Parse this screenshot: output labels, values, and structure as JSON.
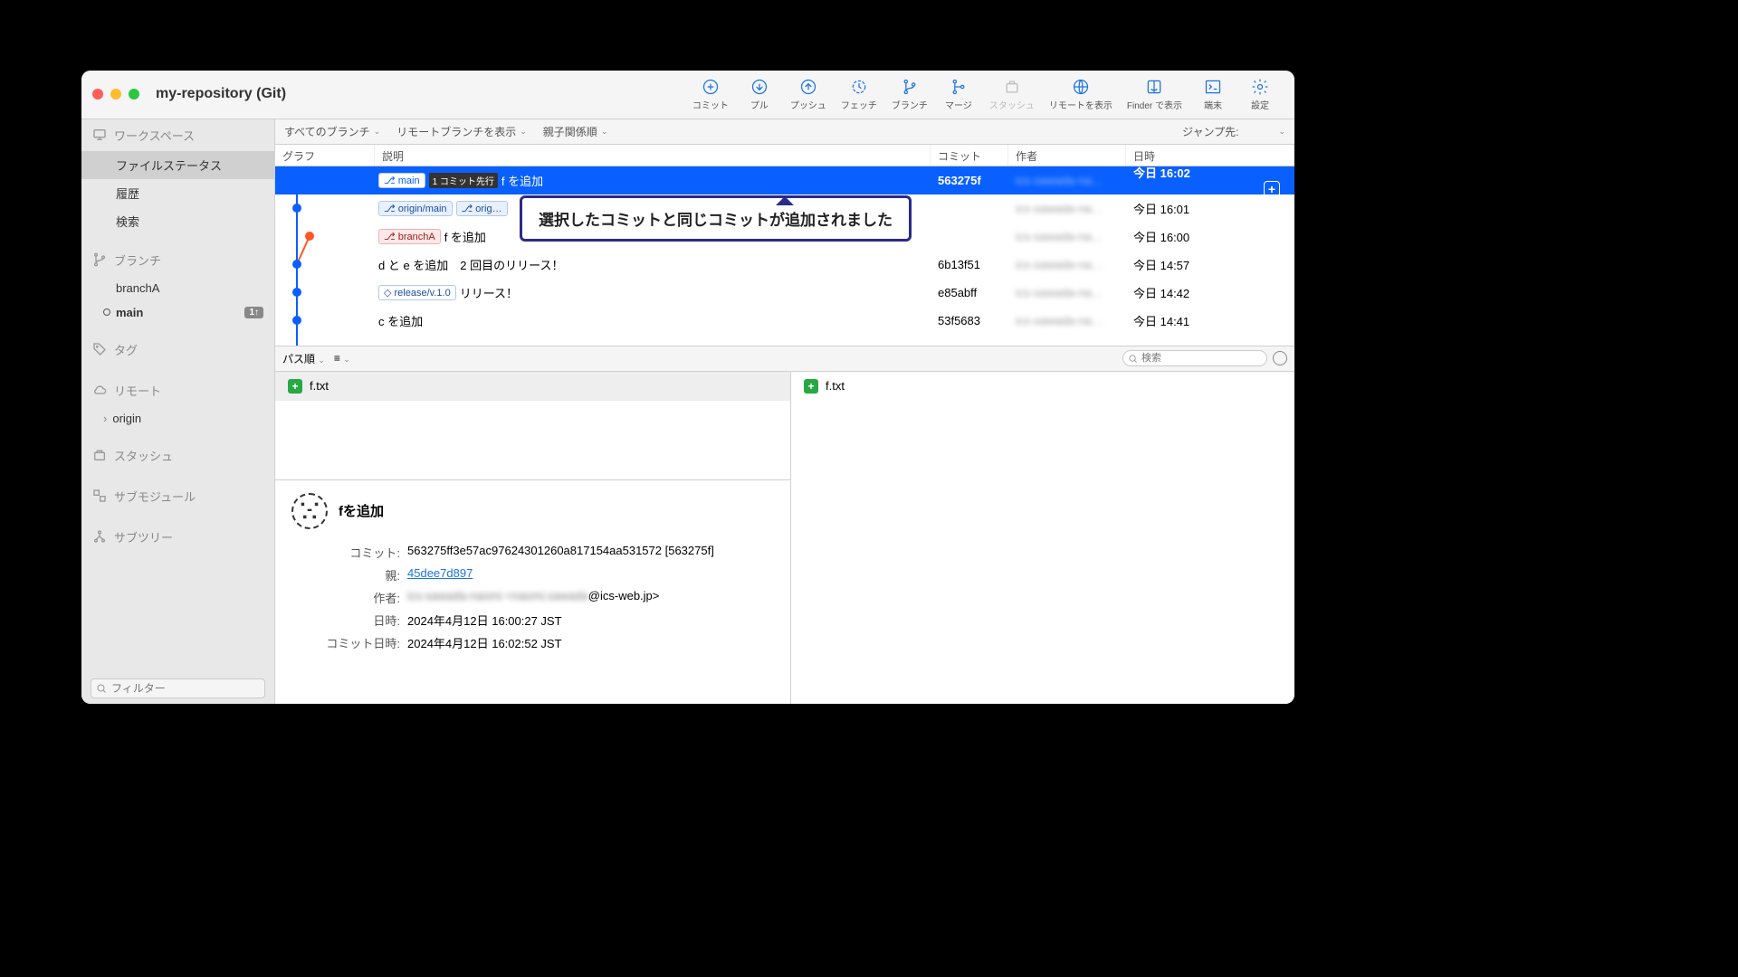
{
  "title": "my-repository (Git)",
  "toolbar": [
    {
      "id": "commit",
      "label": "コミット",
      "icon": "plus-circle"
    },
    {
      "id": "pull",
      "label": "プル",
      "icon": "down-circle"
    },
    {
      "id": "push",
      "label": "プッシュ",
      "icon": "up-circle"
    },
    {
      "id": "fetch",
      "label": "フェッチ",
      "icon": "refresh"
    },
    {
      "id": "branch",
      "label": "ブランチ",
      "icon": "branch"
    },
    {
      "id": "merge",
      "label": "マージ",
      "icon": "merge"
    },
    {
      "id": "stash",
      "label": "スタッシュ",
      "icon": "stash",
      "disabled": true
    },
    {
      "id": "remote",
      "label": "リモートを表示",
      "icon": "globe"
    },
    {
      "id": "finder",
      "label": "Finder で表示",
      "icon": "finder"
    },
    {
      "id": "terminal",
      "label": "端末",
      "icon": "terminal"
    },
    {
      "id": "settings",
      "label": "設定",
      "icon": "gear"
    }
  ],
  "sidebar": {
    "workspace": {
      "label": "ワークスペース",
      "items": [
        "ファイルステータス",
        "履歴",
        "検索"
      ],
      "selected": 0
    },
    "branches": {
      "label": "ブランチ",
      "items": [
        {
          "name": "branchA"
        },
        {
          "name": "main",
          "current": true,
          "badge": "1↑"
        }
      ]
    },
    "tags": {
      "label": "タグ"
    },
    "remotes": {
      "label": "リモート",
      "items": [
        "origin"
      ]
    },
    "stashes": {
      "label": "スタッシュ"
    },
    "submodules": {
      "label": "サブモジュール"
    },
    "subtrees": {
      "label": "サブツリー"
    },
    "filter_placeholder": "フィルター"
  },
  "filterbar": {
    "all_branches": "すべてのブランチ",
    "show_remote": "リモートブランチを表示",
    "order": "親子関係順",
    "jump": "ジャンプ先:"
  },
  "columns": {
    "graph": "グラフ",
    "desc": "説明",
    "commit": "コミット",
    "author": "作者",
    "date": "日時"
  },
  "commits": [
    {
      "refs": [
        {
          "t": "b",
          "n": "main"
        }
      ],
      "ahead": "1 コミット先行",
      "msg": "f を追加",
      "hash": "563275f",
      "author": "ics-sawada-na…",
      "date": "今日 16:02",
      "selected": true,
      "plus": true
    },
    {
      "refs": [
        {
          "t": "r",
          "n": "origin/main"
        },
        {
          "t": "r",
          "n": "orig…"
        }
      ],
      "msg": "",
      "hash": "",
      "author": "ics-sawada-na…",
      "date": "今日 16:01"
    },
    {
      "refs": [
        {
          "t": "lb",
          "n": "branchA"
        }
      ],
      "msg": "f を追加",
      "hash": "",
      "author": "ics-sawada-na…",
      "date": "今日 16:00"
    },
    {
      "refs": [],
      "msg": "d と e を追加　2 回目のリリース！",
      "hash": "6b13f51",
      "author": "ics-sawada-na…",
      "date": "今日 14:57"
    },
    {
      "refs": [
        {
          "t": "tag",
          "n": "release/v.1.0"
        }
      ],
      "msg": "リリース！",
      "hash": "e85abff",
      "author": "ics-sawada-na…",
      "date": "今日 14:42"
    },
    {
      "refs": [],
      "msg": "c を追加",
      "hash": "53f5683",
      "author": "ics-sawada-na…",
      "date": "今日 14:41"
    }
  ],
  "callout": "選択したコミットと同じコミットが追加されました",
  "detail": {
    "path_order": "パス順",
    "search_placeholder": "検索",
    "files": [
      "f.txt"
    ],
    "right_file": "f.txt",
    "title": "fを追加",
    "labels": {
      "commit": "コミット:",
      "parent": "親:",
      "author": "作者:",
      "date": "日時:",
      "commit_date": "コミット日時:"
    },
    "commit_hash": "563275ff3e57ac97624301260a817154aa531572 [563275f]",
    "parent": "45dee7d897",
    "author_blur": "ics-sawada-naomi <naomi.sawada",
    "author_suffix": "@ics-web.jp>",
    "date": "2024年4月12日 16:00:27 JST",
    "commit_date": "2024年4月12日 16:02:52 JST"
  }
}
